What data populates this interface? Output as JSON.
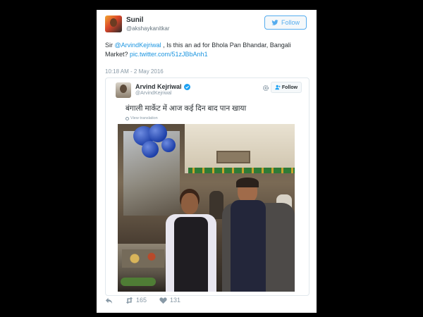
{
  "tweet": {
    "author_name": "Sunil",
    "author_handle": "@akshaykanitkar",
    "follow_label": "Follow",
    "text_prefix": "Sir ",
    "mention": "@ArvindKejriwal",
    "text_body": " , Is this an ad for Bhola Pan Bhandar, Bangali Market? ",
    "link": "pic.twitter.com/51zJBbAnh1",
    "timestamp": "10:18 AM - 2 May 2016",
    "retweets": "165",
    "likes": "131"
  },
  "quoted": {
    "author_name": "Arvind Kejriwal",
    "author_handle": "@ArvindKejriwal",
    "follow_label": "Follow",
    "text": "बंगाली मार्केट में आज कई दिन बाद पान खाया",
    "translate_label": "View translation"
  },
  "colors": {
    "accent": "#55acee",
    "link": "#1b95e0",
    "muted": "#8899a6"
  },
  "icons": [
    "twitter-bird-icon",
    "verified-icon",
    "gear-icon",
    "add-user-icon",
    "globe-icon",
    "reply-icon",
    "retweet-icon",
    "heart-icon"
  ]
}
